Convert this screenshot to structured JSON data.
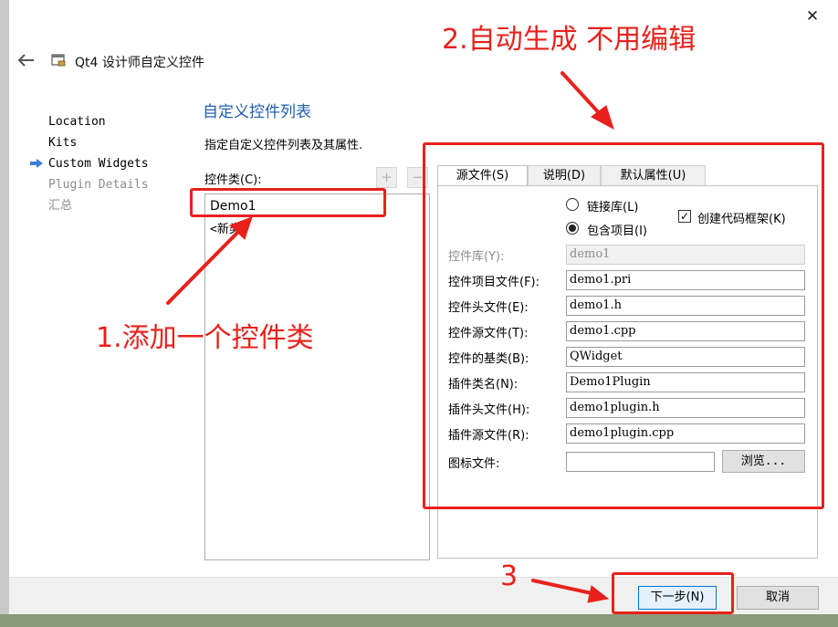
{
  "window": {
    "title": "Qt4 设计师自定义控件",
    "close_glyph": "✕"
  },
  "wizard_steps": [
    {
      "label": "Location",
      "current": false,
      "enabled": true
    },
    {
      "label": "Kits",
      "current": false,
      "enabled": true
    },
    {
      "label": "Custom Widgets",
      "current": true,
      "enabled": true
    },
    {
      "label": "Plugin Details",
      "current": false,
      "enabled": false
    },
    {
      "label": "汇总",
      "current": false,
      "enabled": false
    }
  ],
  "page": {
    "title": "自定义控件列表",
    "subtitle": "指定自定义控件列表及其属性.",
    "class_label": "控件类(C):",
    "add_glyph": "+",
    "remove_glyph": "−",
    "classes": [
      "Demo1",
      "<新类>"
    ]
  },
  "tabs": [
    {
      "label": "源文件(S)",
      "active": true
    },
    {
      "label": "说明(D)",
      "active": false
    },
    {
      "label": "默认属性(U)",
      "active": false
    }
  ],
  "options": {
    "link_library_label": "链接库(L)",
    "link_library_checked": false,
    "include_project_label": "包含项目(I)",
    "include_project_checked": true,
    "create_skeleton_label": "创建代码框架(K)",
    "create_skeleton_checked": true
  },
  "fields": [
    {
      "label": "控件库(Y):",
      "value": "demo1",
      "enabled": false
    },
    {
      "label": "控件项目文件(F):",
      "value": "demo1.pri",
      "enabled": true
    },
    {
      "label": "控件头文件(E):",
      "value": "demo1.h",
      "enabled": true
    },
    {
      "label": "控件源文件(T):",
      "value": "demo1.cpp",
      "enabled": true
    },
    {
      "label": "控件的基类(B):",
      "value": "QWidget",
      "enabled": true
    },
    {
      "label": "插件类名(N):",
      "value": "Demo1Plugin",
      "enabled": true
    },
    {
      "label": "插件头文件(H):",
      "value": "demo1plugin.h",
      "enabled": true
    },
    {
      "label": "插件源文件(R):",
      "value": "demo1plugin.cpp",
      "enabled": true
    },
    {
      "label": "图标文件:",
      "value": "",
      "enabled": true
    }
  ],
  "browse_label": "浏览...",
  "footer": {
    "next_label": "下一步(N)",
    "cancel_label": "取消"
  },
  "annotations": {
    "step1": "1.添加一个控件类",
    "step2": "2.自动生成 不用编辑",
    "step3": "3",
    "color": "#e8211c"
  },
  "colors": {
    "title_blue": "#1f5fb0",
    "step_arrow": "#3b7dd8",
    "button_focus": "#0078d7"
  }
}
